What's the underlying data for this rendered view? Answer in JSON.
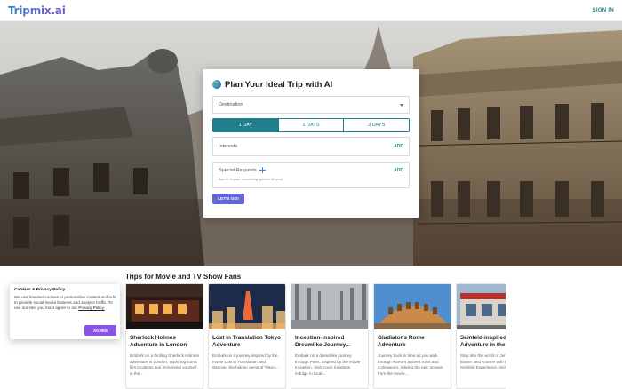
{
  "header": {
    "logo": "Tripmix.ai",
    "signin": "SIGN IN"
  },
  "planner": {
    "title": "Plan Your Ideal Trip with AI",
    "destination_placeholder": "Destination",
    "day_tabs": [
      "1 DAY",
      "2 DAYS",
      "3 DAYS"
    ],
    "active_day": "1 DAY",
    "interests_label": "Interests",
    "add_label": "ADD",
    "special_label": "Special Requests",
    "special_hint": "Ask AI to plan something special for you!",
    "go_label": "LET'S GO!"
  },
  "trips": {
    "title": "Trips for Movie and TV Show Fans",
    "cards": [
      {
        "title": "Sherlock Holmes Adventure in London",
        "desc": "Embark on a thrilling Sherlock Holmes adventure in London, exploring iconic film locations and immersing yourself in the..."
      },
      {
        "title": "Lost in Translation Tokyo Adventure",
        "desc": "Embark on a journey inspired by the movie Lost in Translation and discover the hidden gems of Tokyo,..."
      },
      {
        "title": "Inception-inspired Dreamlike Journey...",
        "desc": "Embark on a dreamlike journey through Paris, inspired by the movie Inception. Visit iconic locations, indulge in local..."
      },
      {
        "title": "Gladiator's Rome Adventure",
        "desc": "Journey back in time as you walk through Rome's ancient ruins and Colosseum, reliving the epic scenes from the movie..."
      },
      {
        "title": "Seinfeld-inspired Adventure in the",
        "desc": "Step into the world of Jerry, George, Elaine, and Kramer with the New York Seinfeld Experience. Visit iconic..."
      }
    ]
  },
  "cookie": {
    "title": "Cookies & Privacy Policy",
    "text": "We use browser cookies to personalize content and Ads, to provide social media features and analyse traffic. To use our site, you must agree to our",
    "link": "Privacy Policy.",
    "agree_label": "AGREE"
  }
}
